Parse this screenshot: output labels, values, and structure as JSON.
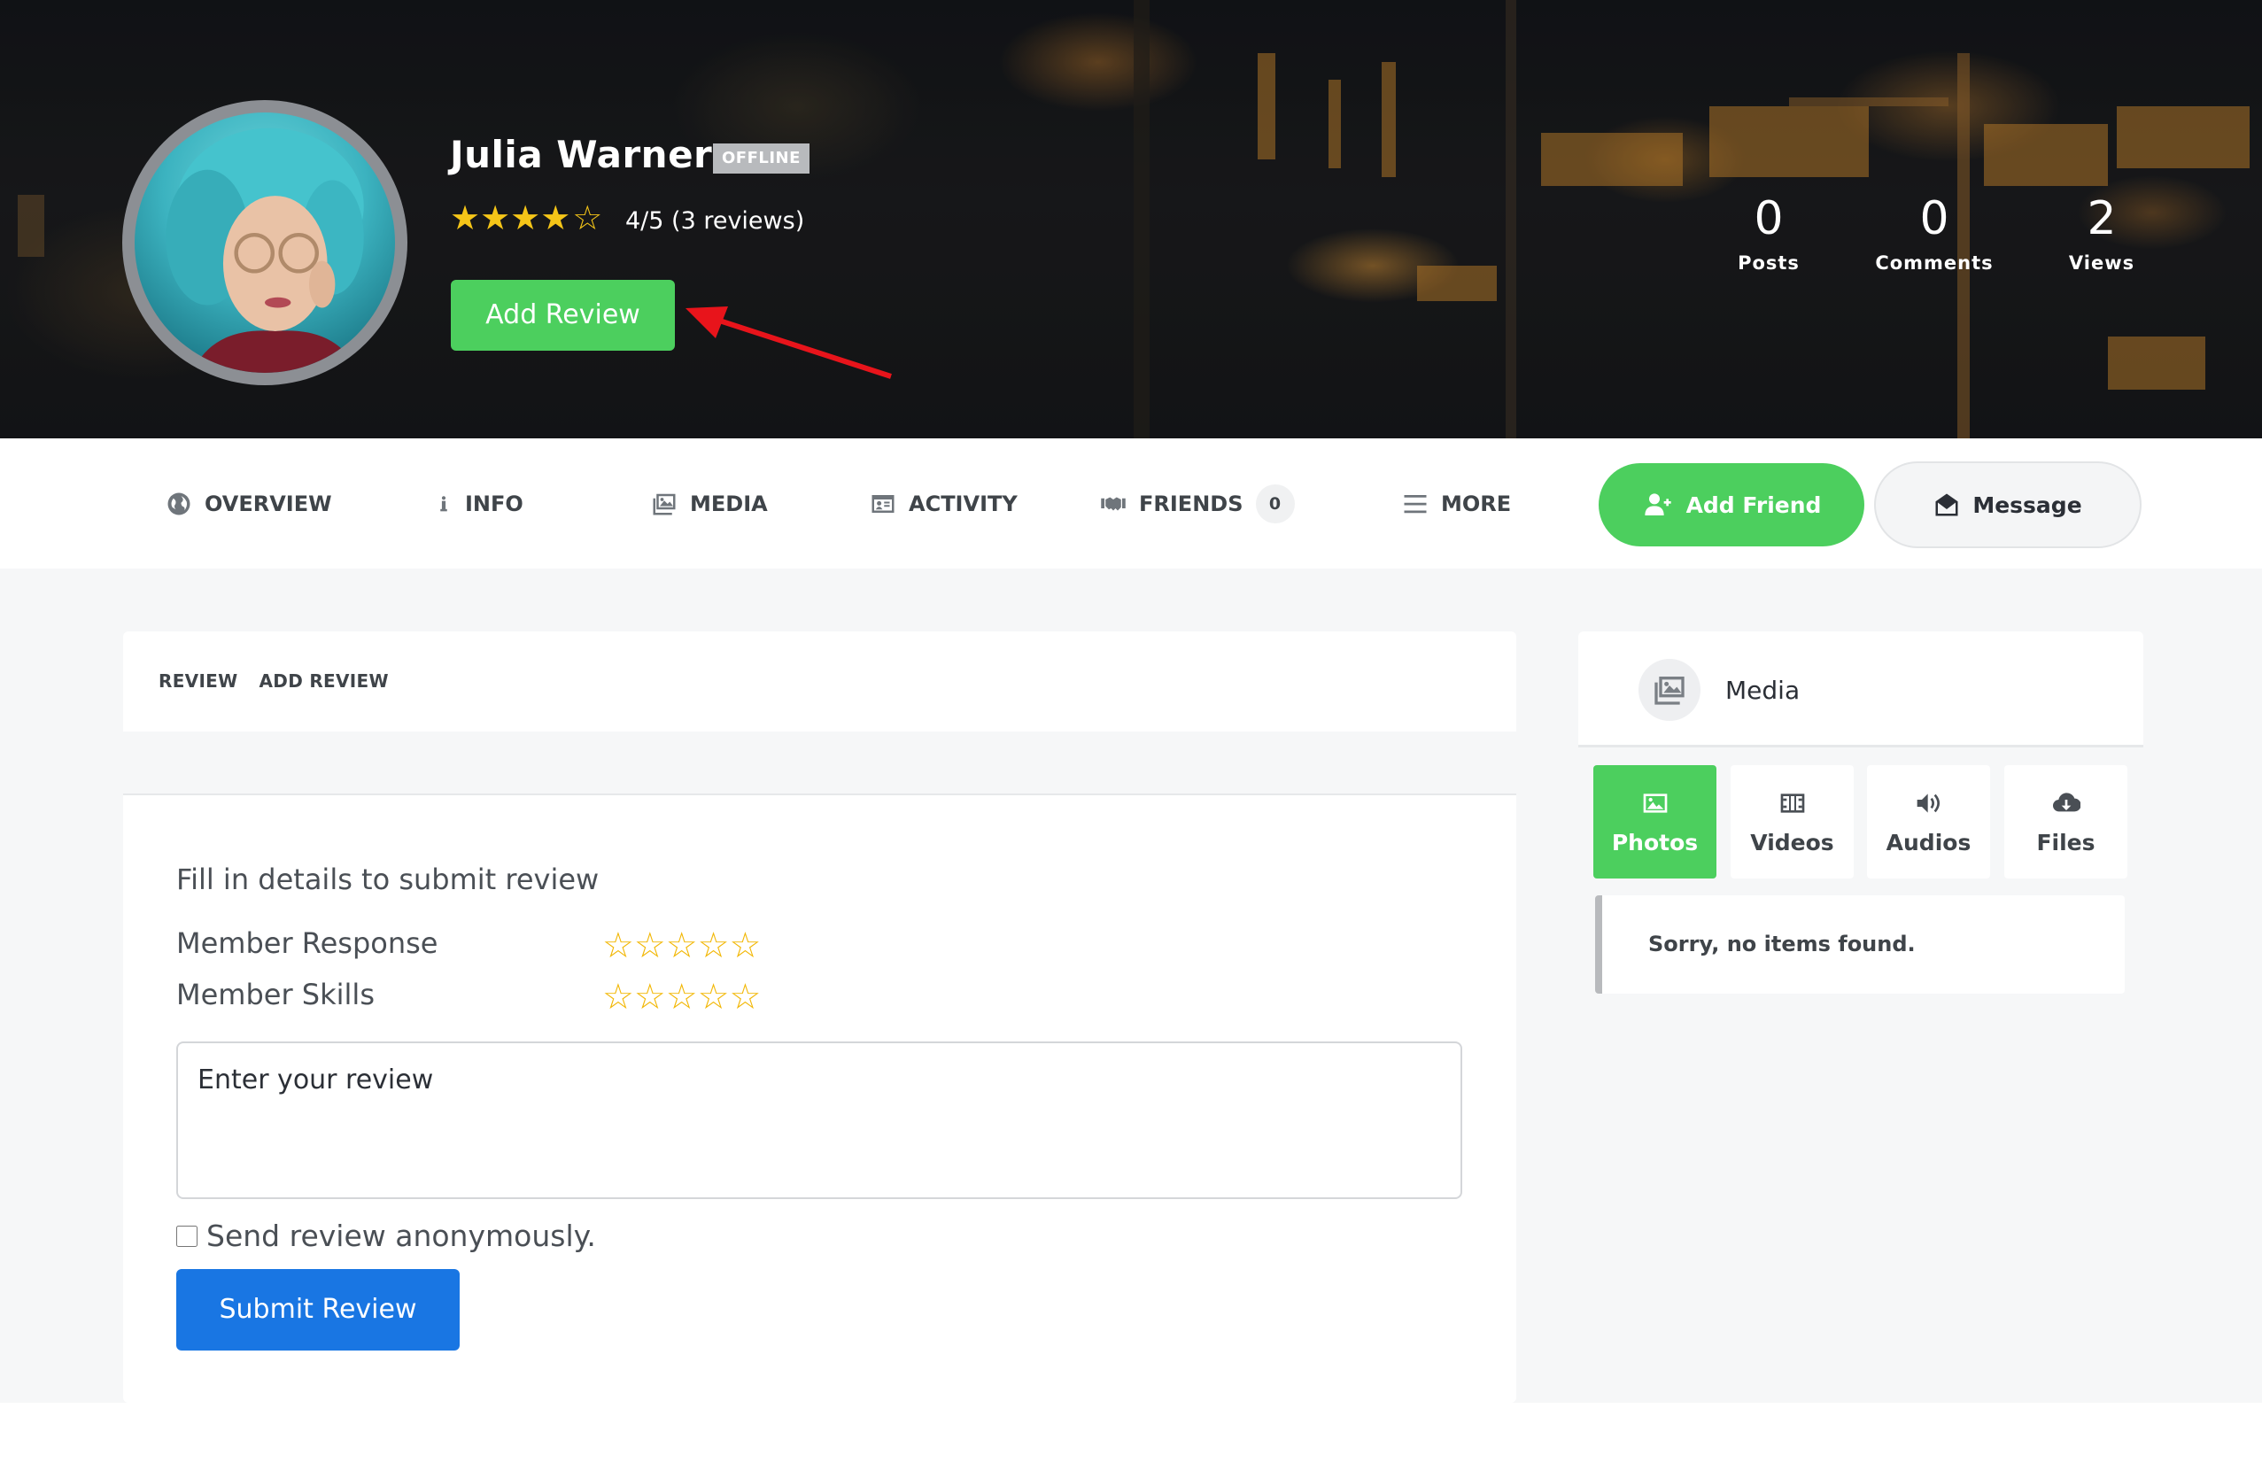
{
  "profile": {
    "name": "Julia Warner",
    "status_badge": "OFFLINE",
    "rating_stars": {
      "filled": "★★★★",
      "empty": "☆"
    },
    "rating_text": "4/5 (3 reviews)",
    "add_review_label": "Add Review",
    "stats": [
      {
        "value": "0",
        "label": "Posts"
      },
      {
        "value": "0",
        "label": "Comments"
      },
      {
        "value": "2",
        "label": "Views"
      }
    ]
  },
  "nav": {
    "items": [
      {
        "label": "OVERVIEW",
        "icon": "globe-icon"
      },
      {
        "label": "INFO",
        "icon": "info-icon"
      },
      {
        "label": "MEDIA",
        "icon": "photos-icon"
      },
      {
        "label": "ACTIVITY",
        "icon": "id-card-icon"
      },
      {
        "label": "FRIENDS",
        "icon": "handshake-icon",
        "count": "0"
      },
      {
        "label": "MORE",
        "icon": "menu-icon"
      }
    ],
    "add_friend_label": "Add Friend",
    "message_label": "Message"
  },
  "review_card": {
    "tabs": [
      "REVIEW",
      "ADD REVIEW"
    ],
    "form_title": "Fill in details to submit review",
    "criteria": [
      {
        "label": "Member Response",
        "stars": "☆☆☆☆☆"
      },
      {
        "label": "Member Skills",
        "stars": "☆☆☆☆☆"
      }
    ],
    "review_placeholder": "Enter your review",
    "anonymous_label": "Send review anonymously.",
    "submit_label": "Submit Review"
  },
  "media_widget": {
    "title": "Media",
    "tabs": [
      {
        "label": "Photos",
        "icon": "image-icon",
        "active": true
      },
      {
        "label": "Videos",
        "icon": "film-icon",
        "active": false
      },
      {
        "label": "Audios",
        "icon": "volume-icon",
        "active": false
      },
      {
        "label": "Files",
        "icon": "cloud-download-icon",
        "active": false
      }
    ],
    "empty_message": "Sorry, no items found."
  },
  "colors": {
    "accent_green": "#4ccf5e",
    "submit_blue": "#1976e3",
    "star_yellow": "#f5c518",
    "annotation_arrow": "#e8141b"
  }
}
